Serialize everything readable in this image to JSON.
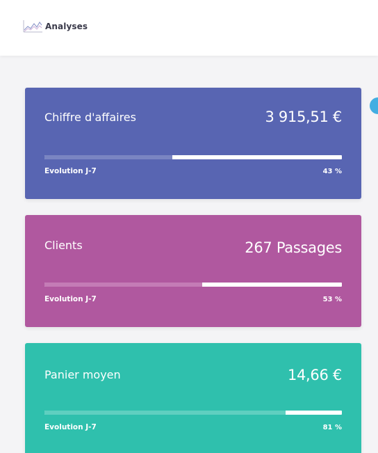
{
  "header": {
    "title": "Analyses",
    "icon": "line-chart-icon"
  },
  "cards": [
    {
      "title": "Chiffre d'affaires",
      "value": "3 915,51 €",
      "progress_label": "Evolution J-7",
      "progress_text": "43 %",
      "progress_fraction": 0.43,
      "color": "#5865b2",
      "track_fill_color": "#7a85c2"
    },
    {
      "title": "Clients",
      "value": "267 Passages",
      "progress_label": "Evolution J-7",
      "progress_text": "53 %",
      "progress_fraction": 0.53,
      "color": "#b0589f",
      "track_fill_color": "#c47cb6"
    },
    {
      "title": "Panier moyen",
      "value": "14,66 €",
      "progress_label": "Evolution J-7",
      "progress_text": "81 %",
      "progress_fraction": 0.81,
      "color": "#2fc0ad",
      "track_fill_color": "#5fcfc0"
    }
  ],
  "colors": {
    "side_indicator": "#43aee2",
    "background": "#f4f4f6"
  }
}
